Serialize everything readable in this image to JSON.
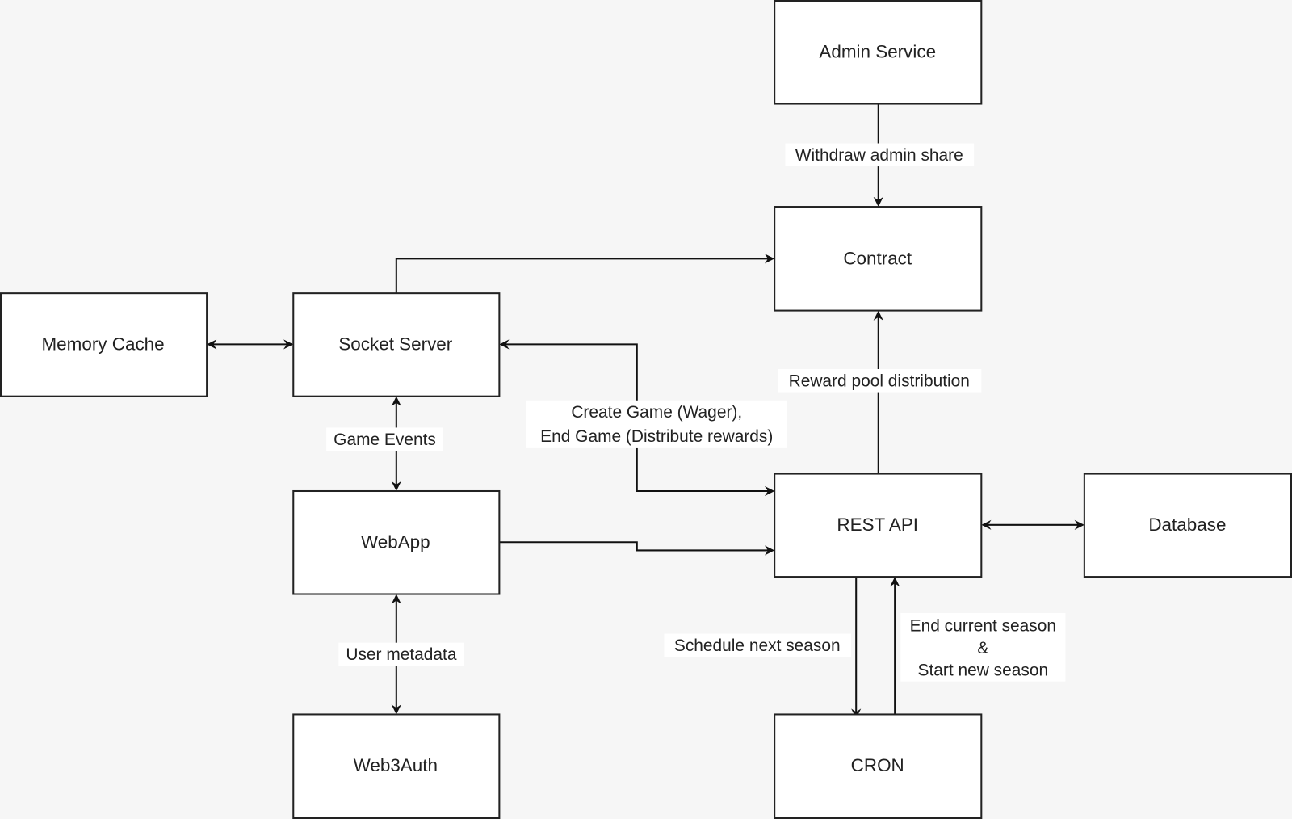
{
  "nodes": {
    "admin_service": "Admin Service",
    "contract": "Contract",
    "memory_cache": "Memory Cache",
    "socket_server": "Socket Server",
    "webapp": "WebApp",
    "web3auth": "Web3Auth",
    "rest_api": "REST API",
    "database": "Database",
    "cron": "CRON"
  },
  "edges": {
    "withdraw": "Withdraw admin share",
    "reward_pool": "Reward pool distribution",
    "create_game_1": "Create Game (Wager),",
    "create_game_2": "End Game (Distribute rewards)",
    "game_events": "Game Events",
    "user_metadata": "User metadata",
    "schedule_next": "Schedule next season",
    "end_season_1": "End current season",
    "end_season_2": "&",
    "end_season_3": "Start new season"
  }
}
